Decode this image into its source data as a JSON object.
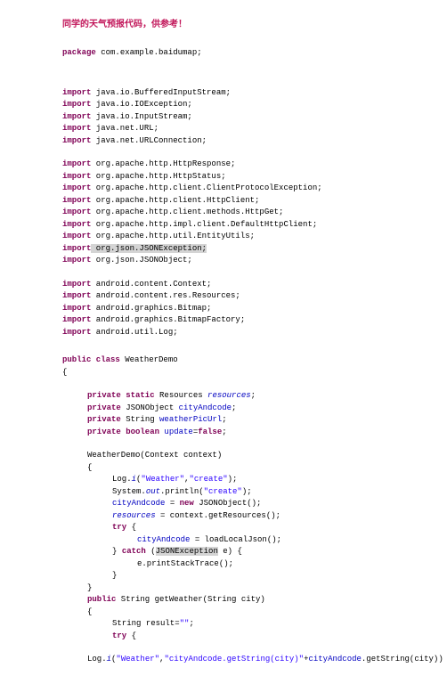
{
  "title": "同学的天气预报代码，供参考！",
  "pkg": {
    "kw": "package",
    "v": " com.example.baidumap;"
  },
  "imp1": [
    {
      "kw": "import",
      "v": " java.io.BufferedInputStream;"
    },
    {
      "kw": "import",
      "v": " java.io.IOException;"
    },
    {
      "kw": "import",
      "v": " java.io.InputStream;"
    },
    {
      "kw": "import",
      "v": " java.net.URL;"
    },
    {
      "kw": "import",
      "v": " java.net.URLConnection;"
    }
  ],
  "imp2": [
    {
      "kw": "import",
      "v": " org.apache.http.HttpResponse;"
    },
    {
      "kw": "import",
      "v": " org.apache.http.HttpStatus;"
    },
    {
      "kw": "import",
      "v": " org.apache.http.client.ClientProtocolException;"
    },
    {
      "kw": "import",
      "v": " org.apache.http.client.HttpClient;"
    },
    {
      "kw": "import",
      "v": " org.apache.http.client.methods.HttpGet;"
    },
    {
      "kw": "import",
      "v": " org.apache.http.impl.client.DefaultHttpClient;"
    },
    {
      "kw": "import",
      "v": " org.apache.http.util.EntityUtils;"
    }
  ],
  "imp2hl": {
    "kw": "import",
    "hl": " org.json.JSONException;"
  },
  "imp2last": {
    "kw": "import",
    "v": " org.json.JSONObject;"
  },
  "imp3": [
    {
      "kw": "import",
      "v": " android.content.Context;"
    },
    {
      "kw": "import",
      "v": " android.content.res.Resources;"
    },
    {
      "kw": "import",
      "v": " android.graphics.Bitmap;"
    },
    {
      "kw": "import",
      "v": " android.graphics.BitmapFactory;"
    },
    {
      "kw": "import",
      "v": " android.util.Log;"
    }
  ],
  "cls": {
    "p": "public class",
    "name": " WeatherDemo"
  },
  "f1": {
    "a": "private static",
    "b": " Resources ",
    "c": "resources",
    "d": ";"
  },
  "f2": {
    "a": "private",
    "b": " JSONObject ",
    "c": "cityAndcode",
    "d": ";"
  },
  "f3": {
    "a": "private",
    "b": " String ",
    "c": "weatherPicUrl",
    "d": ";"
  },
  "f4": {
    "a": "private boolean",
    "b": " ",
    "c": "update",
    "d": "=",
    "e": "false",
    "f": ";"
  },
  "ctor": "WeatherDemo(Context context)",
  "c1": {
    "a": "Log.",
    "b": "i",
    "c": "(",
    "s1": "\"Weather\"",
    "d": ",",
    "s2": "\"create\"",
    "e": ");"
  },
  "c2": {
    "a": "System.",
    "b": "out",
    "c": ".println(",
    "s": "\"create\"",
    "d": ");"
  },
  "c3": {
    "a": "cityAndcode",
    "b": " = ",
    "c": "new",
    "d": " JSONObject();"
  },
  "c4": {
    "a": "resources",
    "b": " = context.getResources();"
  },
  "try": "try",
  "ob": " {",
  "c5": {
    "a": "cityAndcode",
    "b": " = loadLocalJson();"
  },
  "catch": {
    "a": "} ",
    "b": "catch",
    "c": " (",
    "hl": "JSONException",
    "d": " e) {"
  },
  "c6": "e.printStackTrace();",
  "cb": "}",
  "m2": {
    "a": "public",
    "b": " String getWeather(String city)"
  },
  "m2a": {
    "a": "String result=",
    "s": "\"\"",
    "b": ";"
  },
  "m2try": {
    "a": "try",
    "b": " {"
  },
  "log": {
    "a": "Log.",
    "b": "i",
    "c": "(",
    "s1": "\"Weather\"",
    "d": ",",
    "s2": "\"cityAndcode.getString(city)\"",
    "e": "+",
    "f": "cityAndcode",
    "g": ".getString(city))"
  }
}
